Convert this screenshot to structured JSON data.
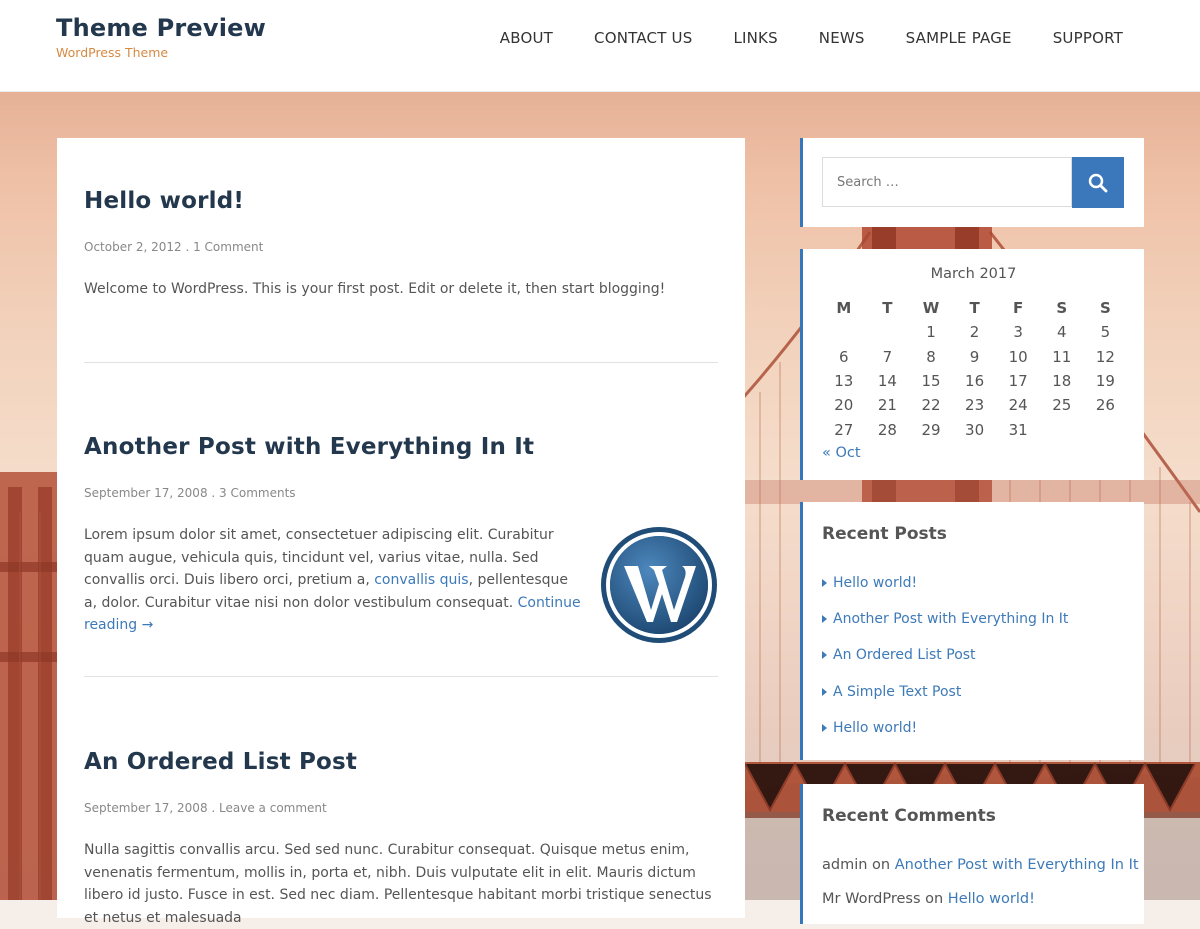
{
  "site": {
    "title": "Theme Preview",
    "description": "WordPress Theme"
  },
  "nav": {
    "items": [
      "ABOUT",
      "CONTACT US",
      "LINKS",
      "NEWS",
      "SAMPLE PAGE",
      "SUPPORT"
    ]
  },
  "posts": [
    {
      "title": "Hello world!",
      "date": "October 2, 2012",
      "comments": "1 Comment",
      "body": "Welcome to WordPress. This is your first post. Edit or delete it, then start blogging!"
    },
    {
      "title": "Another Post with Everything In It",
      "date": "September 17, 2008",
      "comments": "3 Comments",
      "body_before_link": "Lorem ipsum dolor sit amet, consectetuer adipiscing elit. Curabitur quam augue, vehicula quis, tincidunt vel, varius vitae, nulla. Sed convallis orci. Duis libero orci, pretium a, ",
      "inline_link": "convallis quis",
      "body_after_link": ", pellentesque a, dolor. Curabitur vitae nisi non dolor vestibulum consequat.",
      "continue_reading": "Continue reading →",
      "thumbnail_icon": "wordpress-logo"
    },
    {
      "title": "An Ordered List Post",
      "date": "September 17, 2008",
      "comments": "Leave a comment",
      "body": "Nulla sagittis convallis arcu. Sed sed nunc. Curabitur consequat. Quisque metus enim, venenatis fermentum, mollis in, porta et, nibh. Duis vulputate elit in elit. Mauris dictum libero id justo. Fusce in est. Sed nec diam. Pellentesque habitant morbi tristique senectus et netus et malesuada"
    }
  ],
  "meta_separator": " . ",
  "sidebar": {
    "search": {
      "placeholder": "Search …",
      "button_icon": "search-icon"
    },
    "calendar": {
      "caption": "March 2017",
      "weekdays": [
        "M",
        "T",
        "W",
        "T",
        "F",
        "S",
        "S"
      ],
      "weeks": [
        [
          "",
          "",
          "1",
          "2",
          "3",
          "4",
          "5"
        ],
        [
          "6",
          "7",
          "8",
          "9",
          "10",
          "11",
          "12"
        ],
        [
          "13",
          "14",
          "15",
          "16",
          "17",
          "18",
          "19"
        ],
        [
          "20",
          "21",
          "22",
          "23",
          "24",
          "25",
          "26"
        ],
        [
          "27",
          "28",
          "29",
          "30",
          "31",
          "",
          ""
        ]
      ],
      "prev_link": "« Oct"
    },
    "recent_posts": {
      "title": "Recent Posts",
      "items": [
        "Hello world!",
        "Another Post with Everything In It",
        "An Ordered List Post",
        "A Simple Text Post",
        "Hello world!"
      ]
    },
    "recent_comments": {
      "title": "Recent Comments",
      "items": [
        {
          "author": "admin",
          "on": "on",
          "post": "Another Post with Everything In It"
        },
        {
          "author": "Mr WordPress",
          "on": "on",
          "post": "Hello world!"
        }
      ]
    }
  },
  "colors": {
    "title": "#23374d",
    "accent": "#d58a43",
    "link": "#3d7ab8",
    "button": "#3a77bb"
  }
}
